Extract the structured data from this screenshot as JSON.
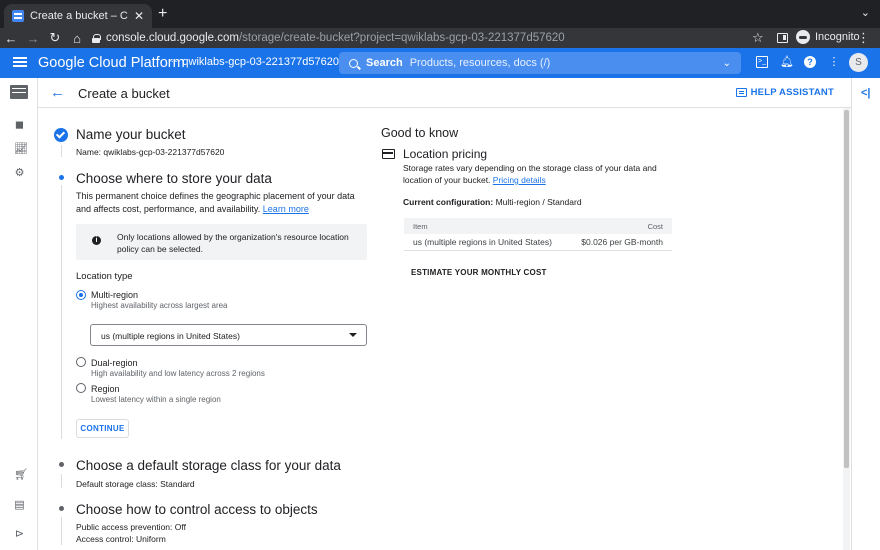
{
  "browser": {
    "tab_title": "Create a bucket – Cloud Storage",
    "url_host": "console.cloud.google.com",
    "url_path": "/storage/create-bucket?project=qwiklabs-gcp-03-221377d57620",
    "profile_label": "Incognito"
  },
  "header": {
    "brand": "Google Cloud Platform",
    "project": "qwiklabs-gcp-03-221377d57620",
    "search_label": "Search",
    "search_placeholder": "Products, resources, docs (/)",
    "avatar_letter": "S"
  },
  "page": {
    "title": "Create a bucket",
    "help_assistant": "HELP ASSISTANT"
  },
  "steps": {
    "name": {
      "title": "Name your bucket",
      "summary_label": "Name:",
      "summary_value": "qwiklabs-gcp-03-221377d57620"
    },
    "location": {
      "title": "Choose where to store your data",
      "description": "This permanent choice defines the geographic placement of your data and affects cost, performance, and availability.",
      "learn_more": "Learn more",
      "info_text": "Only locations allowed by the organization's resource location policy can be selected.",
      "location_type_label": "Location type",
      "options": [
        {
          "title": "Multi-region",
          "desc": "Highest availability across largest area"
        },
        {
          "title": "Dual-region",
          "desc": "High availability and low latency across 2 regions"
        },
        {
          "title": "Region",
          "desc": "Lowest latency within a single region"
        }
      ],
      "selected_region": "us (multiple regions in United States)",
      "continue": "CONTINUE"
    },
    "storage_class": {
      "title": "Choose a default storage class for your data",
      "summary_label": "Default storage class:",
      "summary_value": "Standard"
    },
    "access": {
      "title": "Choose how to control access to objects",
      "pap_label": "Public access prevention:",
      "pap_value": "Off",
      "ac_label": "Access control:",
      "ac_value": "Uniform"
    }
  },
  "good_to_know": {
    "title": "Good to know",
    "pricing_title": "Location pricing",
    "pricing_desc": "Storage rates vary depending on the storage class of your data and location of your bucket.",
    "pricing_link": "Pricing details",
    "current_config_label": "Current configuration:",
    "current_config_value": "Multi-region / Standard",
    "table_headers": [
      "Item",
      "Cost"
    ],
    "table_rows": [
      [
        "us (multiple regions in United States)",
        "$0.026 per GB-month"
      ]
    ],
    "estimate": "ESTIMATE YOUR MONTHLY COST"
  }
}
